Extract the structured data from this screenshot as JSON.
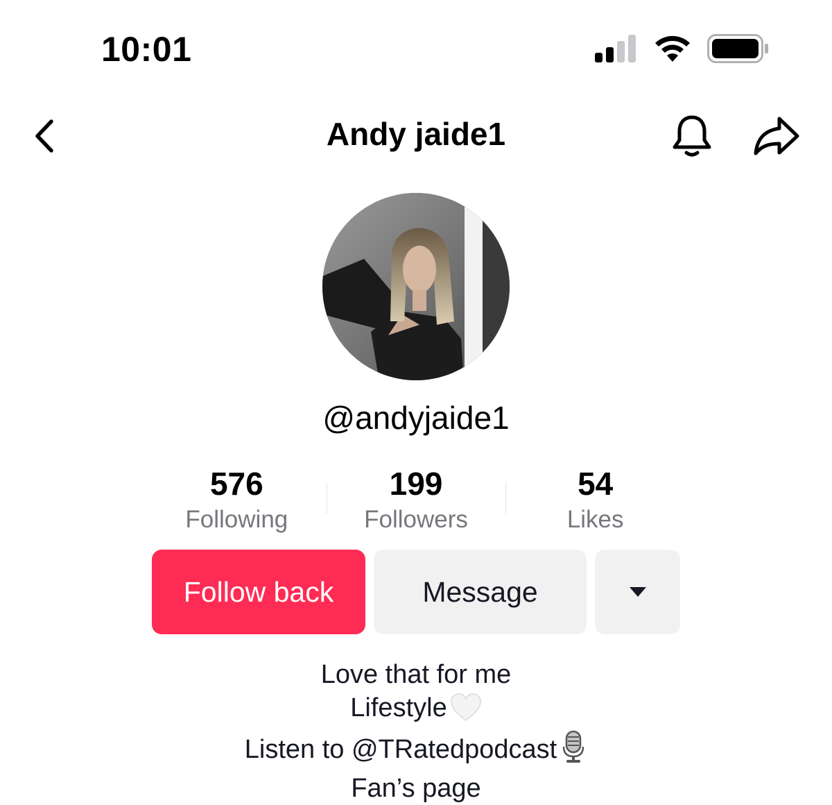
{
  "status_bar": {
    "time": "10:01",
    "signal_icon": "cellular-signal-icon",
    "wifi_icon": "wifi-icon",
    "battery_icon": "battery-icon"
  },
  "header": {
    "title": "Andy jaide1",
    "back_icon": "chevron-left-icon",
    "bell_icon": "bell-icon",
    "share_icon": "share-arrow-icon"
  },
  "profile": {
    "username": "@andyjaide1"
  },
  "stats": [
    {
      "value": "576",
      "label": "Following"
    },
    {
      "value": "199",
      "label": "Followers"
    },
    {
      "value": "54",
      "label": "Likes"
    }
  ],
  "actions": {
    "follow_back_label": "Follow back",
    "message_label": "Message",
    "more_icon": "caret-down-icon"
  },
  "bio": {
    "line1": "Love that for me",
    "line2": "Lifestyle",
    "line2_icon": "white-heart-icon",
    "line3": "Listen to @TRatedpodcast",
    "line3_icon": "microphone-icon",
    "line4": "Fan’s page"
  },
  "colors": {
    "accent": "#fe2c55",
    "secondary_button": "#f1f1f2",
    "muted_text": "#76777c"
  }
}
